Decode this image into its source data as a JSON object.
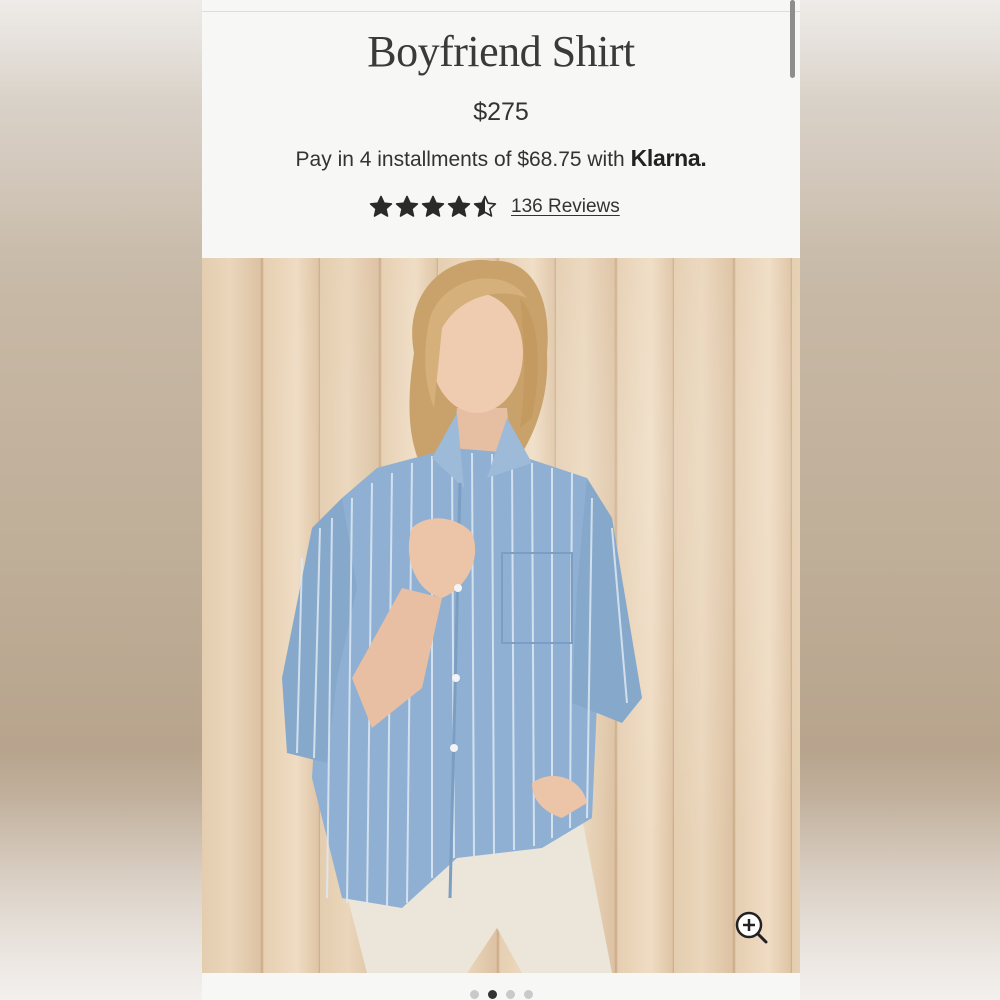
{
  "product": {
    "title": "Boyfriend Shirt",
    "price": "$275",
    "installment_text": "Pay in 4 installments of $68.75 with",
    "klarna_logo": "Klarna.",
    "rating": 4.5,
    "rating_max": 5,
    "reviews_link": "136 Reviews"
  },
  "gallery": {
    "zoom_icon": "zoom-in-icon",
    "image_count": 4,
    "active_index": 1
  },
  "colors": {
    "text": "#333333",
    "background": "#f7f7f5",
    "shirt_blue": "#8fb0d2"
  }
}
